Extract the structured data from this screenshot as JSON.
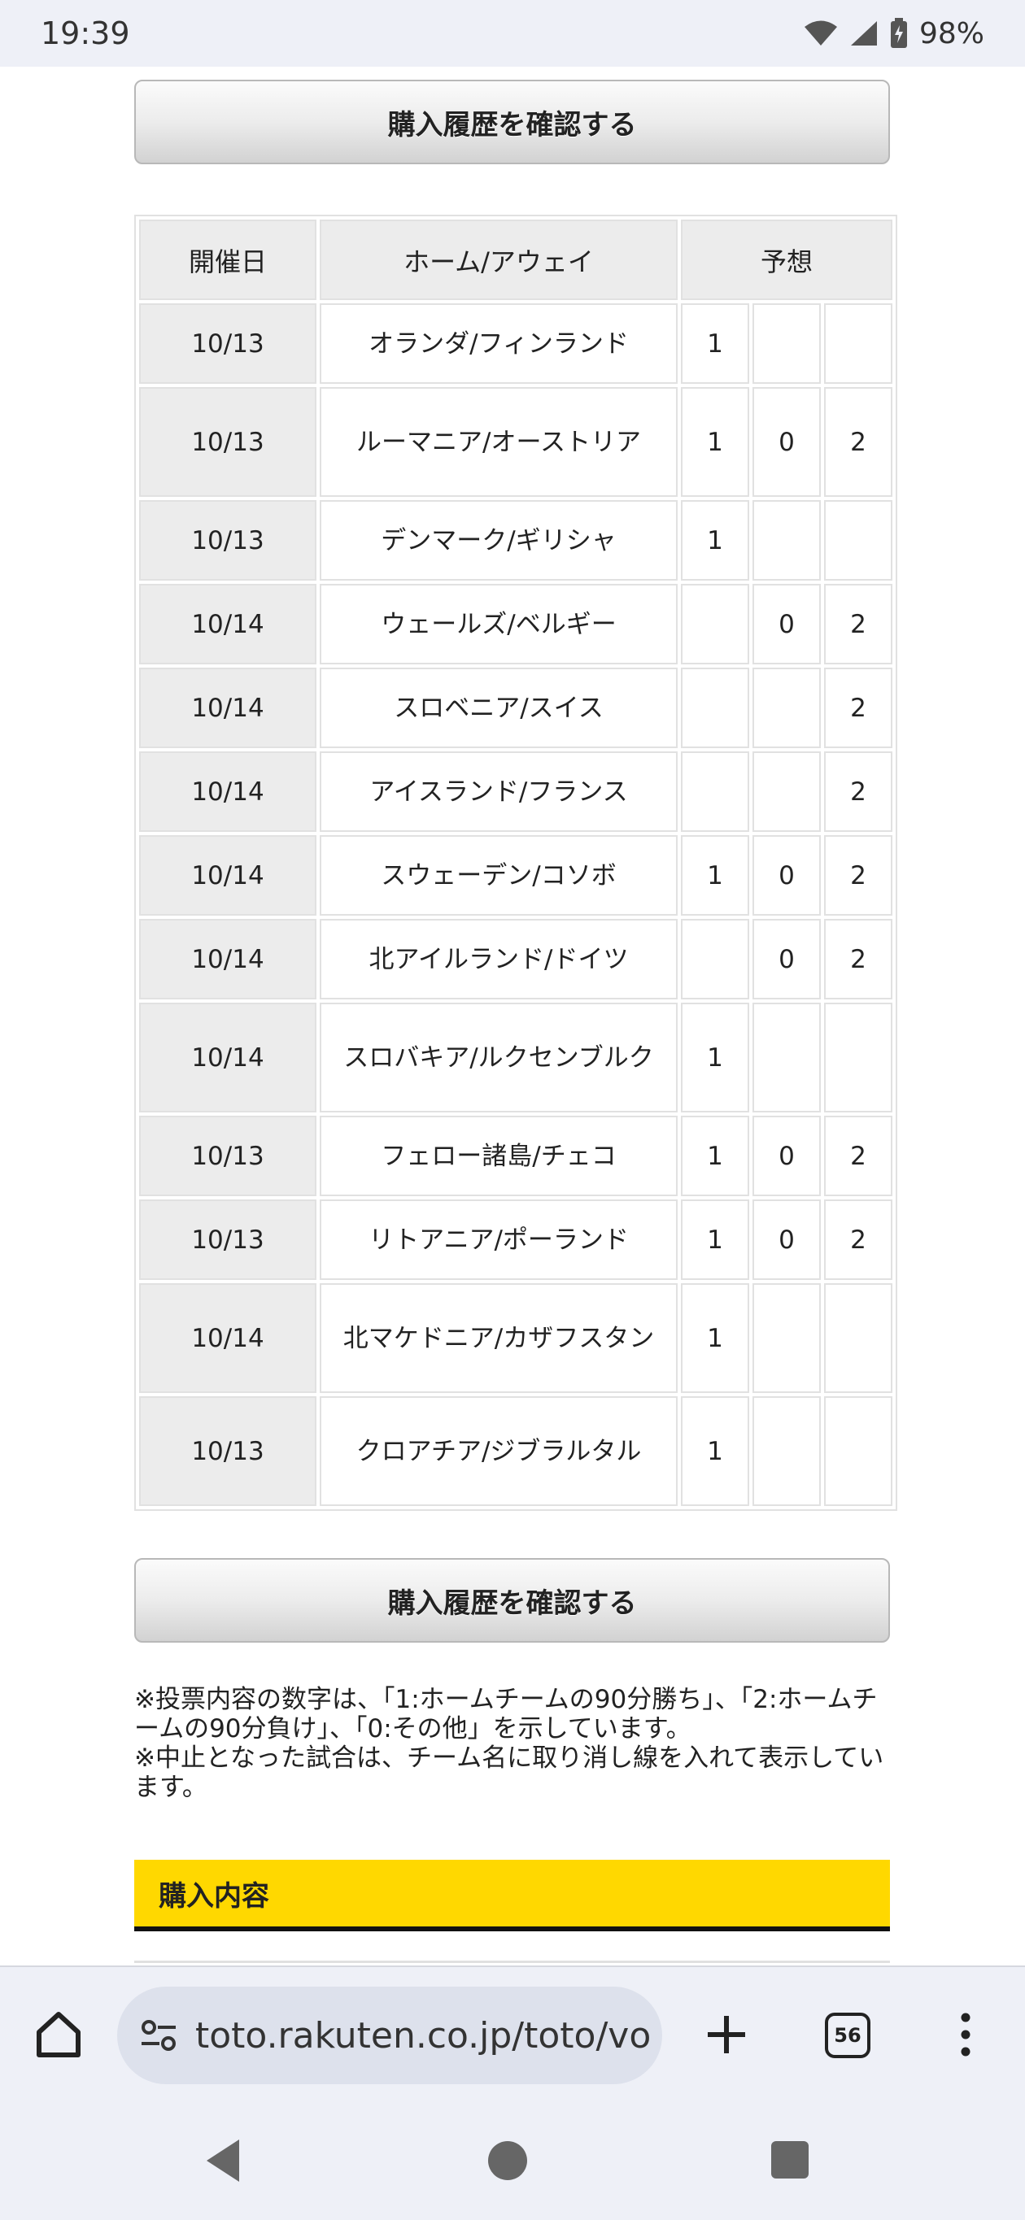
{
  "status_bar": {
    "time": "19:39",
    "battery": "98%",
    "icons": [
      "wifi-icon",
      "signal-icon",
      "battery-icon"
    ]
  },
  "history_button_label": "購入履歴を確認する",
  "table": {
    "headers": [
      "開催日",
      "ホーム/アウェイ",
      "予想"
    ],
    "rows": [
      {
        "date": "10/13",
        "match": "オランダ/フィンランド",
        "p1": "1",
        "p0": "",
        "p2": ""
      },
      {
        "date": "10/13",
        "match": "ルーマニア/オーストリア",
        "p1": "1",
        "p0": "0",
        "p2": "2"
      },
      {
        "date": "10/13",
        "match": "デンマーク/ギリシャ",
        "p1": "1",
        "p0": "",
        "p2": ""
      },
      {
        "date": "10/14",
        "match": "ウェールズ/ベルギー",
        "p1": "",
        "p0": "0",
        "p2": "2"
      },
      {
        "date": "10/14",
        "match": "スロベニア/スイス",
        "p1": "",
        "p0": "",
        "p2": "2"
      },
      {
        "date": "10/14",
        "match": "アイスランド/フランス",
        "p1": "",
        "p0": "",
        "p2": "2"
      },
      {
        "date": "10/14",
        "match": "スウェーデン/コソボ",
        "p1": "1",
        "p0": "0",
        "p2": "2"
      },
      {
        "date": "10/14",
        "match": "北アイルランド/ドイツ",
        "p1": "",
        "p0": "0",
        "p2": "2"
      },
      {
        "date": "10/14",
        "match": "スロバキア/ルクセンブルク",
        "p1": "1",
        "p0": "",
        "p2": ""
      },
      {
        "date": "10/13",
        "match": "フェロー諸島/チェコ",
        "p1": "1",
        "p0": "0",
        "p2": "2"
      },
      {
        "date": "10/13",
        "match": "リトアニア/ポーランド",
        "p1": "1",
        "p0": "0",
        "p2": "2"
      },
      {
        "date": "10/14",
        "match": "北マケドニア/カザフスタン",
        "p1": "1",
        "p0": "",
        "p2": ""
      },
      {
        "date": "10/13",
        "match": "クロアチア/ジブラルタル",
        "p1": "1",
        "p0": "",
        "p2": ""
      }
    ]
  },
  "notes": [
    "※投票内容の数字は、「1:ホームチームの90分勝ち」、「2:ホームチームの90分負け」、「0:その他」を示しています。",
    "※中止となった試合は、チーム名に取り消し線を入れて表示しています。"
  ],
  "section_title": "購入内容",
  "colors": {
    "section_accent": "#ffd800",
    "cell_header_bg": "#ececec"
  },
  "browser": {
    "url": "toto.rakuten.co.jp/toto/vo",
    "tab_count": "56"
  }
}
